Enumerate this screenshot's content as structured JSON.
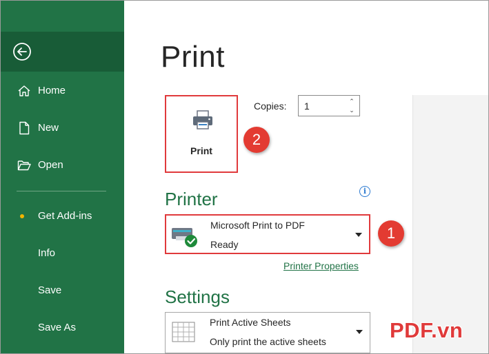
{
  "sidebar": {
    "back_label": "Back",
    "items": [
      {
        "label": "Home"
      },
      {
        "label": "New"
      },
      {
        "label": "Open"
      },
      {
        "label": "Get Add-ins"
      },
      {
        "label": "Info"
      },
      {
        "label": "Save"
      },
      {
        "label": "Save As"
      }
    ]
  },
  "main": {
    "title": "Print",
    "print_button_label": "Print",
    "copies_label": "Copies:",
    "copies_value": "1",
    "printer_heading": "Printer",
    "printer": {
      "name": "Microsoft Print to PDF",
      "status": "Ready"
    },
    "printer_properties_link": "Printer Properties",
    "settings_heading": "Settings",
    "settings_option": {
      "title": "Print Active Sheets",
      "description": "Only print the active sheets"
    }
  },
  "annotations": {
    "badge_1": "1",
    "badge_2": "2"
  },
  "watermark": "PDF.vn",
  "colors": {
    "sidebar": "#217346",
    "sidebar_active": "#185c37",
    "accent_green": "#217346",
    "highlight_red": "#e0393b",
    "addin_dot": "#f0b400"
  }
}
